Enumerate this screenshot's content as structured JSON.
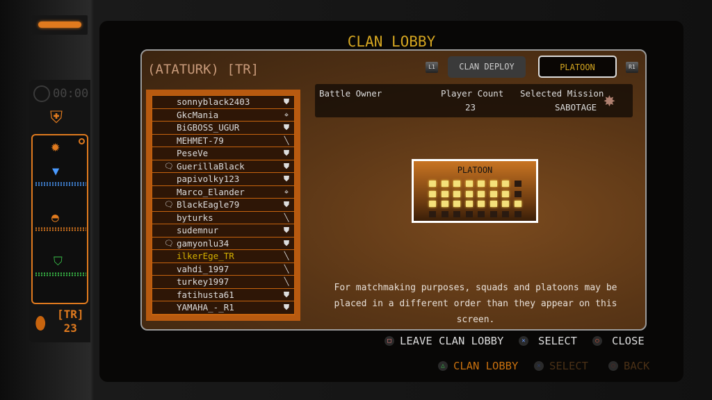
{
  "title": "CLAN LOBBY",
  "clan_name": "(ATATURK) [TR]",
  "tabs": {
    "left_shoulder": "L1",
    "right_shoulder": "R1",
    "clan_deploy": "CLAN DEPLOY",
    "platoon": "PLATOON",
    "active": "PLATOON"
  },
  "info": {
    "battle_owner_label": "Battle Owner",
    "player_count_label": "Player Count",
    "player_count": "23",
    "mission_label": "Selected Mission",
    "mission": "SABOTAGE"
  },
  "sidebar": {
    "timer": "00:00",
    "clan_tag": "[TR]",
    "count": "23"
  },
  "members": [
    {
      "name": "sonnyblack2403",
      "chat": false,
      "icon": "shield"
    },
    {
      "name": "GkcMania",
      "chat": false,
      "icon": "crosshair"
    },
    {
      "name": "BiGBOSS_UGUR",
      "chat": false,
      "icon": "shield"
    },
    {
      "name": "MEHMET-79",
      "chat": false,
      "icon": "knife"
    },
    {
      "name": "PeseVe",
      "chat": false,
      "icon": "shield"
    },
    {
      "name": "GuerillaBlack",
      "chat": true,
      "icon": "shield"
    },
    {
      "name": "papivolky123",
      "chat": false,
      "icon": "shield"
    },
    {
      "name": "Marco_Elander",
      "chat": false,
      "icon": "crosshair"
    },
    {
      "name": "BlackEagle79",
      "chat": true,
      "icon": "shield"
    },
    {
      "name": "byturks",
      "chat": false,
      "icon": "knife"
    },
    {
      "name": "sudemnur",
      "chat": false,
      "icon": "shield"
    },
    {
      "name": "gamyonlu34",
      "chat": true,
      "icon": "shield"
    },
    {
      "name": "ilkerEge_TR",
      "chat": false,
      "icon": "knife",
      "highlight": true
    },
    {
      "name": "vahdi_1997",
      "chat": false,
      "icon": "knife"
    },
    {
      "name": "turkey1997",
      "chat": false,
      "icon": "knife"
    },
    {
      "name": "fatihusta61",
      "chat": false,
      "icon": "shield"
    },
    {
      "name": "YAMAHA_-_R1",
      "chat": false,
      "icon": "shield"
    }
  ],
  "platoon_box": {
    "label": "PLATOON",
    "slots": [
      [
        1,
        1,
        1,
        1,
        1,
        1,
        1,
        0
      ],
      [
        1,
        1,
        1,
        1,
        1,
        1,
        1,
        0
      ],
      [
        1,
        1,
        1,
        1,
        1,
        1,
        1,
        1
      ],
      [
        0,
        0,
        0,
        0,
        0,
        0,
        0,
        0
      ]
    ]
  },
  "note": "For matchmaking purposes, squads and platoons may be placed in a different order than they appear on this screen.",
  "hints": {
    "leave": "LEAVE CLAN LOBBY",
    "select": "SELECT",
    "close": "CLOSE",
    "clan_lobby": "CLAN LOBBY",
    "select2": "SELECT",
    "back": "BACK"
  },
  "colors": {
    "accent": "#e07a1e",
    "gold": "#d4a520",
    "highlight": "#d4b000"
  }
}
